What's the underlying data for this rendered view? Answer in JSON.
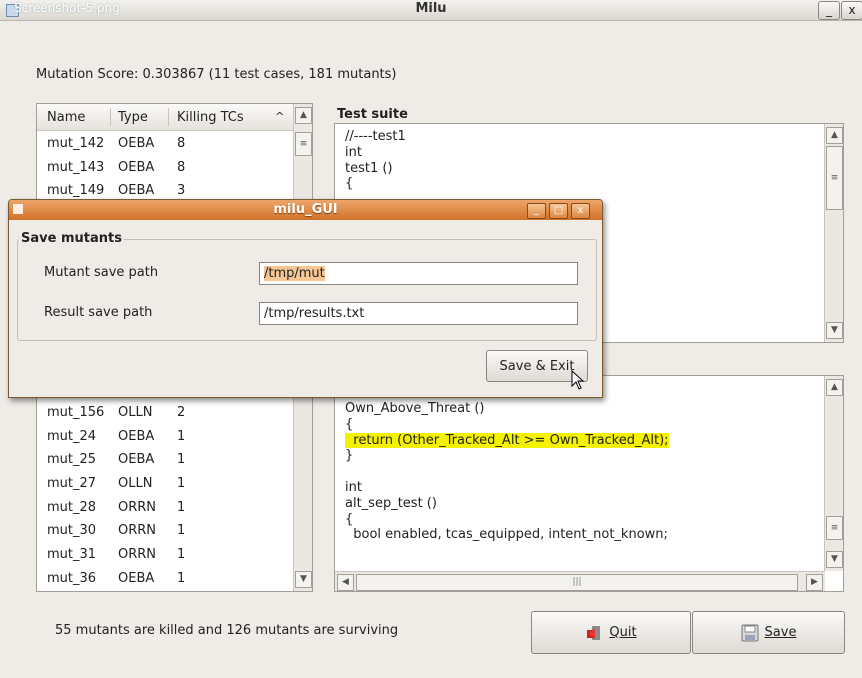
{
  "screenshot_label": "Screenshot-5.png",
  "main_window": {
    "title": "Milu",
    "minimize": "_",
    "close": "x"
  },
  "mutation_score": "Mutation Score: 0.303867 (11 test cases, 181 mutants)",
  "mutant_list": {
    "columns": [
      "Name",
      "Type",
      "Killing TCs"
    ],
    "rows_top": [
      [
        "mut_142",
        "OEBA",
        "8"
      ],
      [
        "mut_143",
        "OEBA",
        "8"
      ],
      [
        "mut_149",
        "OEBA",
        "3"
      ]
    ],
    "rows_bottom": [
      [
        "mut_156",
        "OLLN",
        "2"
      ],
      [
        "mut_24",
        "OEBA",
        "1"
      ],
      [
        "mut_25",
        "OEBA",
        "1"
      ],
      [
        "mut_27",
        "OLLN",
        "1"
      ],
      [
        "mut_28",
        "ORRN",
        "1"
      ],
      [
        "mut_30",
        "ORRN",
        "1"
      ],
      [
        "mut_31",
        "ORRN",
        "1"
      ],
      [
        "mut_36",
        "OEBA",
        "1"
      ]
    ]
  },
  "test_suite": {
    "title": "Test suite",
    "lines": [
      "//----test1",
      "int",
      "test1 ()",
      "{"
    ]
  },
  "mutant_source": {
    "lines": [
      "Own_Above_Threat ()",
      "{",
      "  return (Other_Tracked_Alt >= Own_Tracked_Alt);",
      "}",
      "",
      "int",
      "alt_sep_test ()",
      "{",
      "  bool enabled, tcas_equipped, intent_not_known;"
    ],
    "highlight_index": 2
  },
  "status_text": "55 mutants are killed and 126 mutants are surviving",
  "buttons": {
    "quit": "Quit",
    "save": "Save"
  },
  "dialog": {
    "title": "milu_GUI",
    "frame_label": "Save mutants",
    "mutant_path_label": "Mutant save path",
    "mutant_path_value": "/tmp/mut",
    "result_path_label": "Result save path",
    "result_path_value": "/tmp/results.txt",
    "save_exit": "Save & Exit"
  }
}
